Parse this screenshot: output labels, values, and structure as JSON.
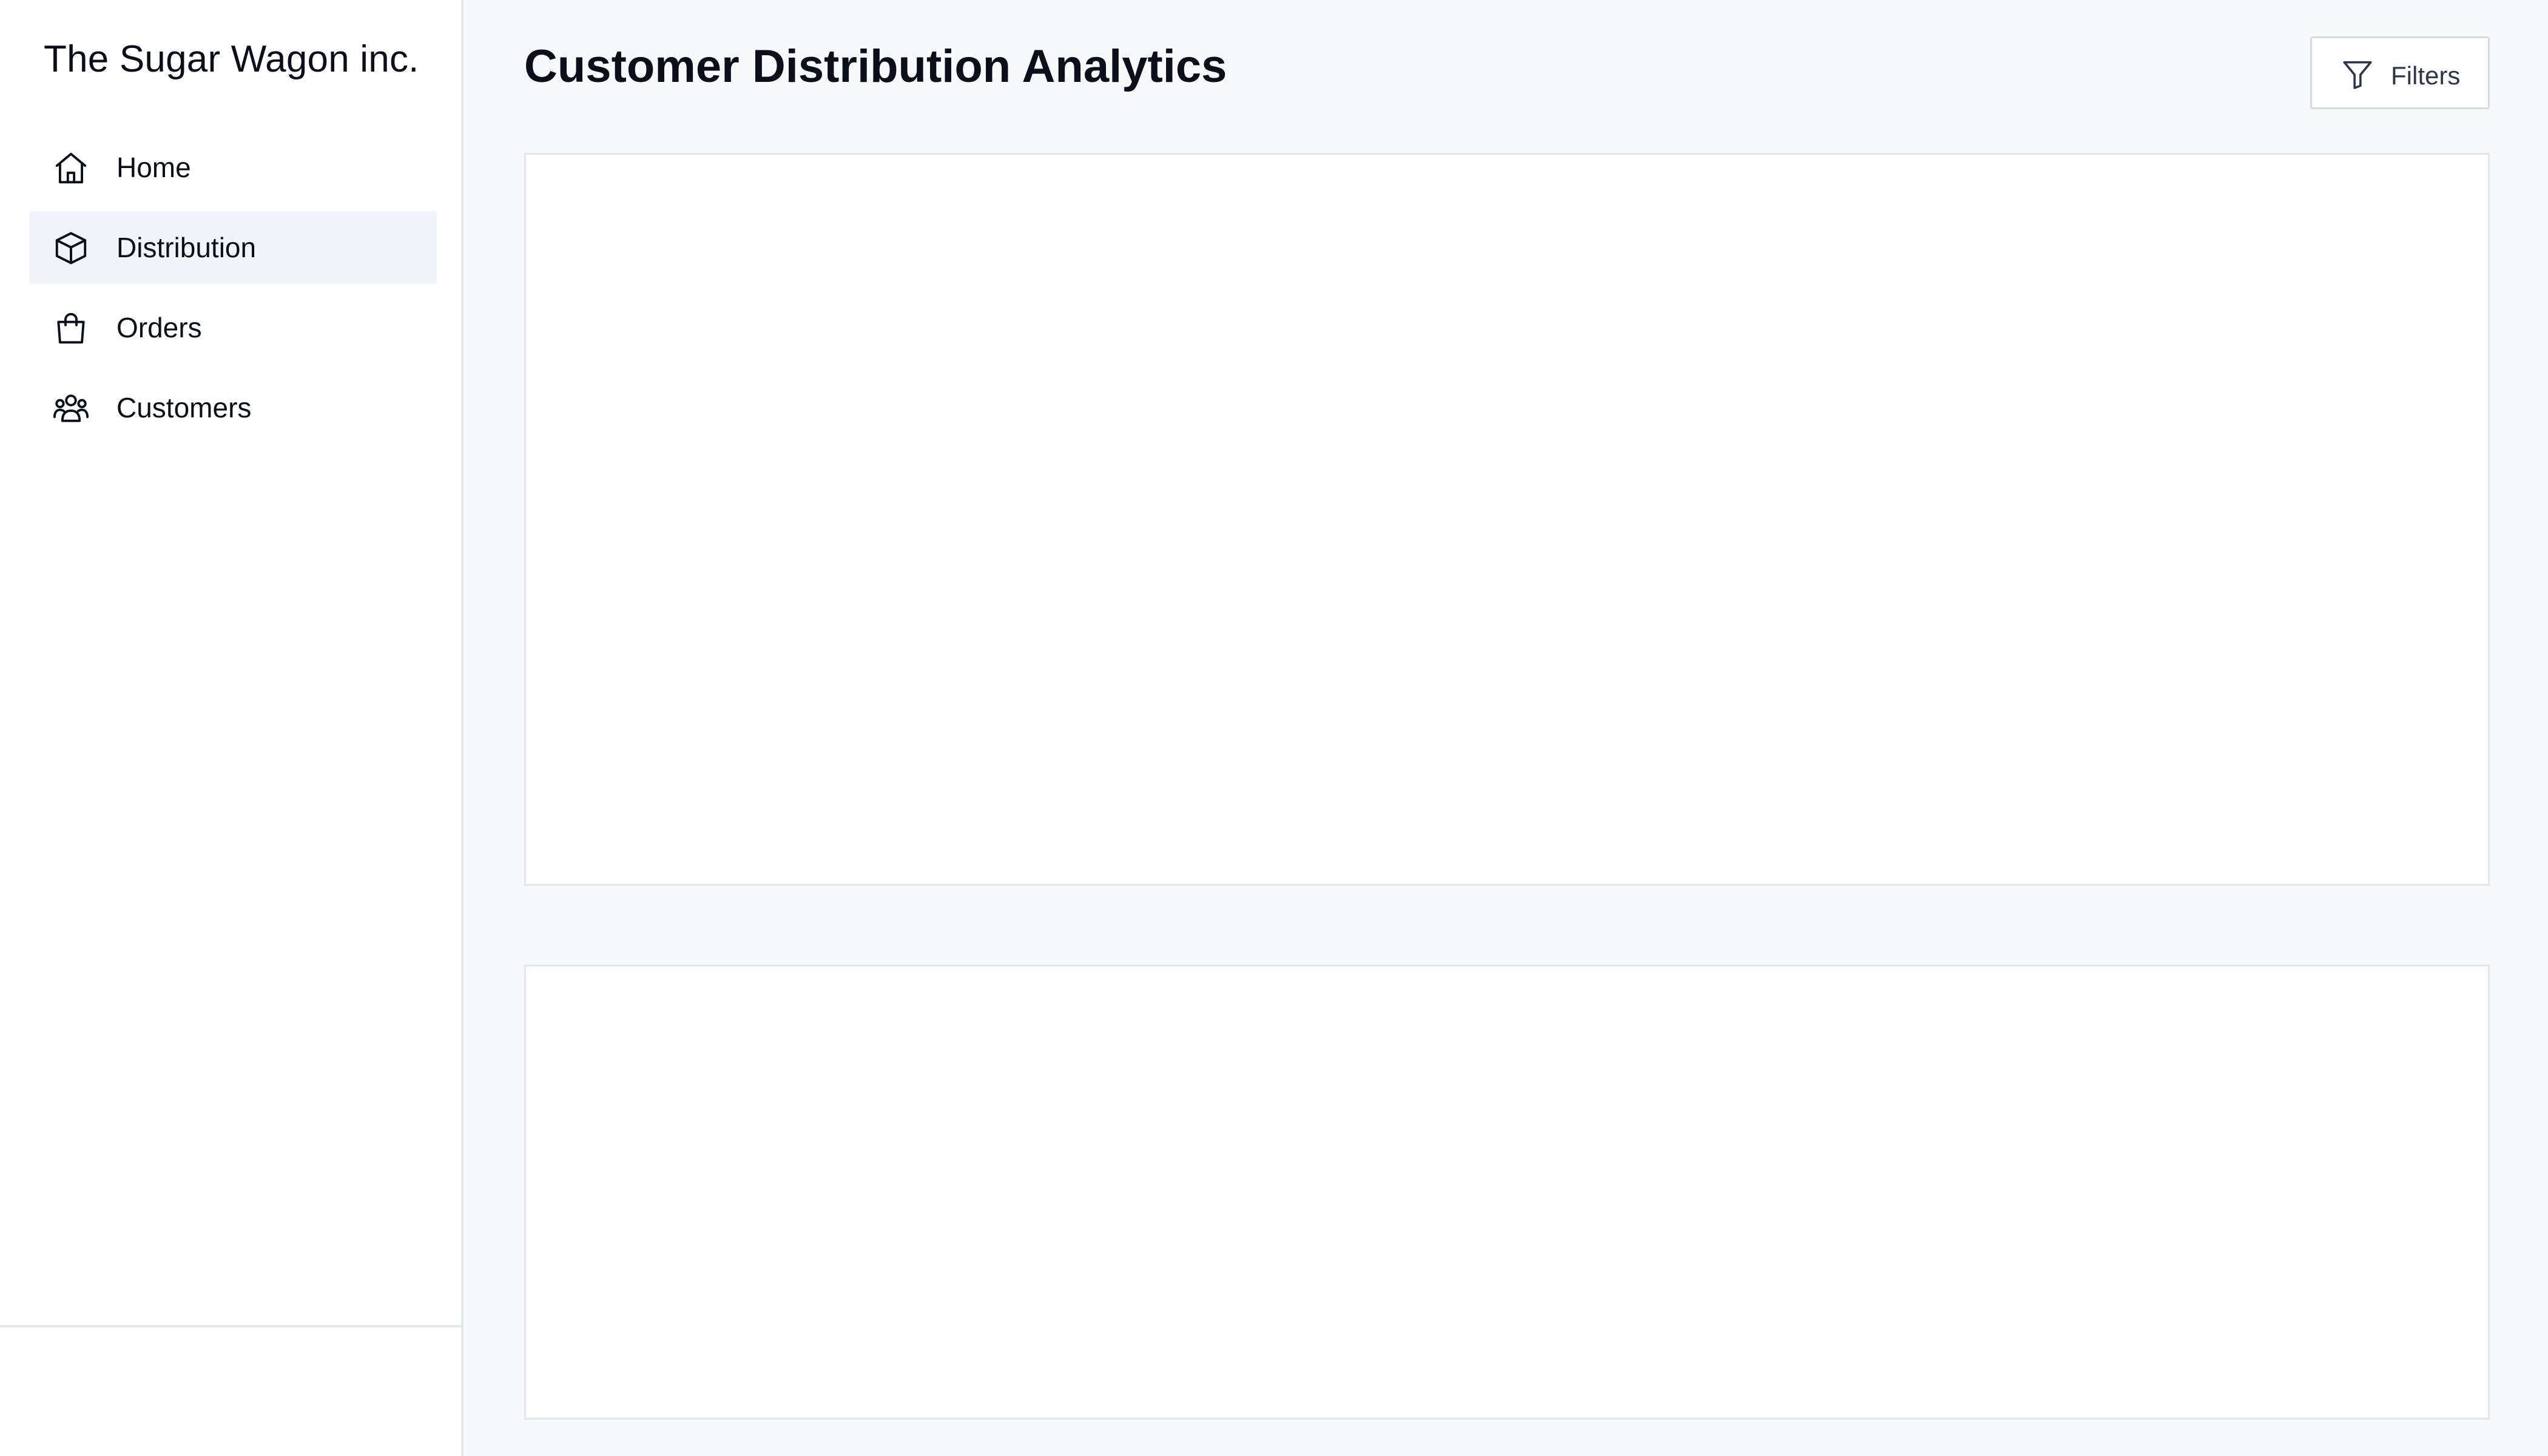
{
  "app": {
    "brand": "The Sugar Wagon inc."
  },
  "sidebar": {
    "items": [
      {
        "label": "Home",
        "icon": "home-icon",
        "active": false
      },
      {
        "label": "Distribution",
        "icon": "cube-icon",
        "active": true
      },
      {
        "label": "Orders",
        "icon": "shopping-bag-icon",
        "active": false
      },
      {
        "label": "Customers",
        "icon": "users-icon",
        "active": false
      }
    ]
  },
  "header": {
    "title": "Customer Distribution Analytics",
    "filters_label": "Filters",
    "filters_icon": "funnel-icon"
  },
  "colors": {
    "background": "#f8f9fb",
    "sidebar_bg": "#ffffff",
    "active_item_bg": "#f1f4f8",
    "border": "#e5e7eb",
    "text": "#0b0f19"
  }
}
